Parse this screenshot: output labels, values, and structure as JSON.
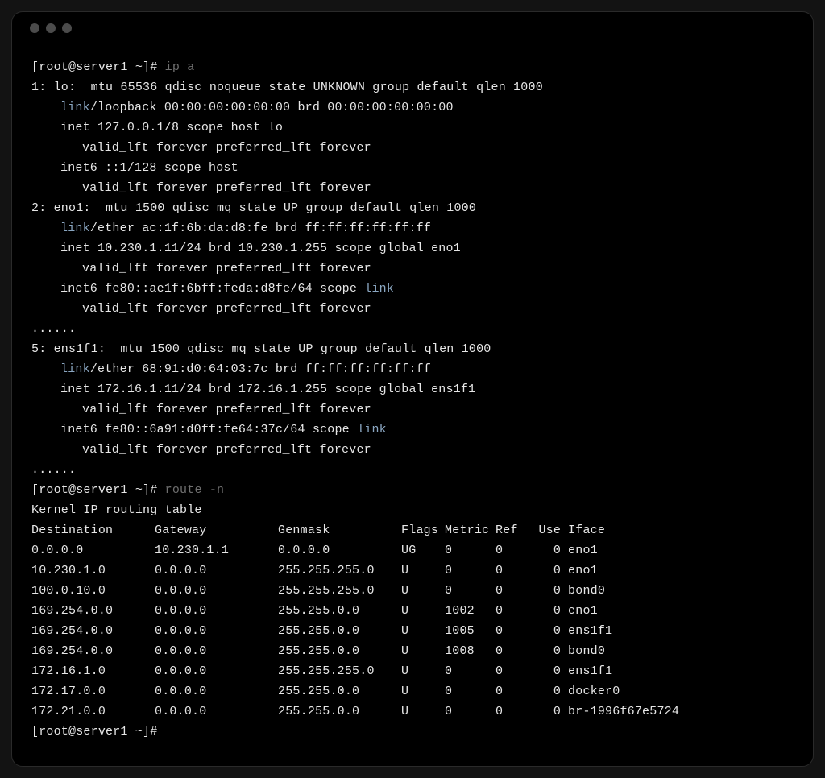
{
  "prompt": "[root@server1 ~]#",
  "commands": {
    "ip_a": "ip a",
    "route_n": "route -n"
  },
  "word_link": "link",
  "interfaces": [
    {
      "header": "1: lo:  mtu 65536 qdisc noqueue state UNKNOWN group default qlen 1000",
      "link_suffix": "/loopback 00:00:00:00:00:00 brd 00:00:00:00:00:00",
      "addrs": [
        {
          "line": "inet 127.0.0.1/8 scope host lo",
          "scope_link": false,
          "valid": "valid_lft forever preferred_lft forever"
        },
        {
          "line": "inet6 ::1/128 scope host",
          "scope_link": false,
          "valid": "valid_lft forever preferred_lft forever"
        }
      ],
      "trailer": null
    },
    {
      "header": "2: eno1:  mtu 1500 qdisc mq state UP group default qlen 1000",
      "link_suffix": "/ether ac:1f:6b:da:d8:fe brd ff:ff:ff:ff:ff:ff",
      "addrs": [
        {
          "line": "inet 10.230.1.11/24 brd 10.230.1.255 scope global eno1",
          "scope_link": false,
          "valid": "valid_lft forever preferred_lft forever"
        },
        {
          "line": "inet6 fe80::ae1f:6bff:feda:d8fe/64 scope ",
          "scope_link": true,
          "valid": "valid_lft forever preferred_lft forever"
        }
      ],
      "trailer": "......"
    },
    {
      "header": "5: ens1f1:  mtu 1500 qdisc mq state UP group default qlen 1000",
      "link_suffix": "/ether 68:91:d0:64:03:7c brd ff:ff:ff:ff:ff:ff",
      "addrs": [
        {
          "line": "inet 172.16.1.11/24 brd 172.16.1.255 scope global ens1f1",
          "scope_link": false,
          "valid": "valid_lft forever preferred_lft forever"
        },
        {
          "line": "inet6 fe80::6a91:d0ff:fe64:37c/64 scope ",
          "scope_link": true,
          "valid": "valid_lft forever preferred_lft forever"
        }
      ],
      "trailer": "......"
    }
  ],
  "route_title": "Kernel IP routing table",
  "route_header": {
    "dest": "Destination",
    "gw": "Gateway",
    "mask": "Genmask",
    "flags": "Flags",
    "metric": "Metric",
    "ref": "Ref",
    "use": "Use",
    "iface": "Iface"
  },
  "routes": [
    {
      "dest": "0.0.0.0",
      "gw": "10.230.1.1",
      "mask": "0.0.0.0",
      "flags": "UG",
      "metric": "0",
      "ref": "0",
      "use": "0",
      "iface": "eno1"
    },
    {
      "dest": "10.230.1.0",
      "gw": "0.0.0.0",
      "mask": "255.255.255.0",
      "flags": "U",
      "metric": "0",
      "ref": "0",
      "use": "0",
      "iface": "eno1"
    },
    {
      "dest": "100.0.10.0",
      "gw": "0.0.0.0",
      "mask": "255.255.255.0",
      "flags": "U",
      "metric": "0",
      "ref": "0",
      "use": "0",
      "iface": "bond0"
    },
    {
      "dest": "169.254.0.0",
      "gw": "0.0.0.0",
      "mask": "255.255.0.0",
      "flags": "U",
      "metric": "1002",
      "ref": "0",
      "use": "0",
      "iface": "eno1"
    },
    {
      "dest": "169.254.0.0",
      "gw": "0.0.0.0",
      "mask": "255.255.0.0",
      "flags": "U",
      "metric": "1005",
      "ref": "0",
      "use": "0",
      "iface": "ens1f1"
    },
    {
      "dest": "169.254.0.0",
      "gw": "0.0.0.0",
      "mask": "255.255.0.0",
      "flags": "U",
      "metric": "1008",
      "ref": "0",
      "use": "0",
      "iface": "bond0"
    },
    {
      "dest": "172.16.1.0",
      "gw": "0.0.0.0",
      "mask": "255.255.255.0",
      "flags": "U",
      "metric": "0",
      "ref": "0",
      "use": "0",
      "iface": "ens1f1"
    },
    {
      "dest": "172.17.0.0",
      "gw": "0.0.0.0",
      "mask": "255.255.0.0",
      "flags": "U",
      "metric": "0",
      "ref": "0",
      "use": "0",
      "iface": "docker0"
    },
    {
      "dest": "172.21.0.0",
      "gw": "0.0.0.0",
      "mask": "255.255.0.0",
      "flags": "U",
      "metric": "0",
      "ref": "0",
      "use": "0",
      "iface": "br-1996f67e5724"
    }
  ]
}
